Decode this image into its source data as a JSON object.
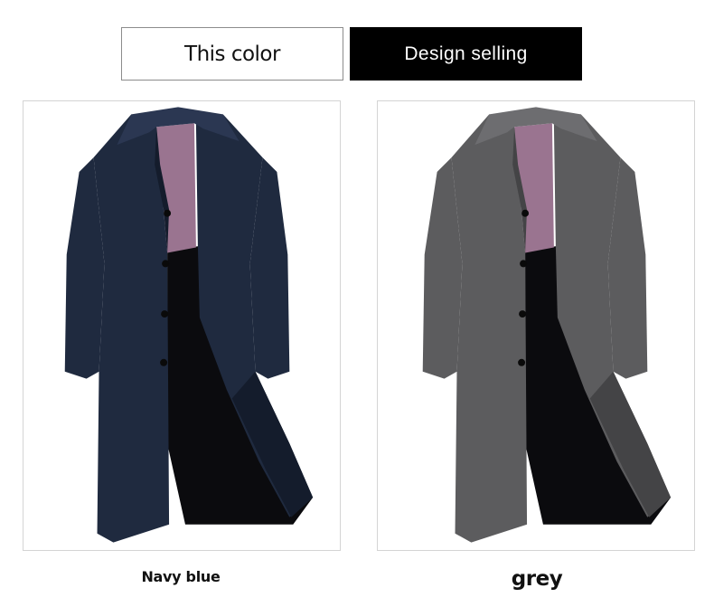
{
  "tabs": {
    "this_color": "This color",
    "design_selling": "Design selling"
  },
  "products": [
    {
      "caption": "Navy blue",
      "image_icon": "coat-image-icon",
      "coat_color": "#1f2a3f",
      "coat_shade": "#141c2c",
      "coat_highlight": "#2b3752"
    },
    {
      "caption": "grey",
      "image_icon": "coat-image-icon",
      "coat_color": "#5c5c5e",
      "coat_shade": "#444446",
      "coat_highlight": "#6d6d70"
    }
  ],
  "colors": {
    "active_tab_bg": "#000000",
    "inactive_tab_border": "#8c8c8c",
    "card_border": "#d4d4d4",
    "lining": "#9a7490",
    "inner_lining": "#0b0b0e"
  }
}
